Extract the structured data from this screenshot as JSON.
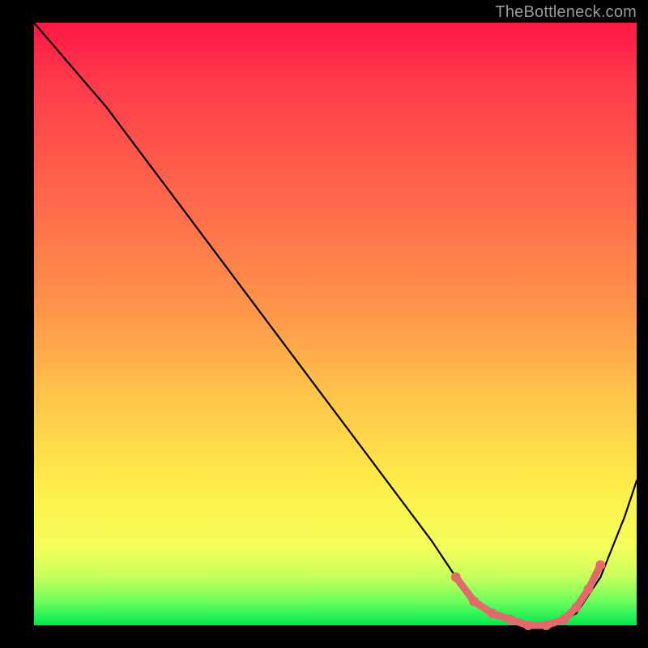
{
  "watermark": "TheBottleneck.com",
  "chart_data": {
    "type": "line",
    "title": "",
    "xlabel": "",
    "ylabel": "",
    "xlim": [
      0,
      100
    ],
    "ylim": [
      0,
      100
    ],
    "series": [
      {
        "name": "bottleneck-curve",
        "x": [
          0,
          6,
          12,
          18,
          24,
          30,
          36,
          42,
          48,
          54,
          60,
          66,
          70,
          74,
          78,
          82,
          86,
          90,
          94,
          98,
          100
        ],
        "y": [
          100,
          93,
          86,
          78,
          70,
          62,
          54,
          46,
          38,
          30,
          22,
          14,
          8,
          3,
          1,
          0,
          0,
          2,
          8,
          18,
          24
        ]
      }
    ],
    "highlight": {
      "name": "optimal-range",
      "x": [
        70,
        73,
        76,
        79,
        82,
        85,
        88,
        90,
        92,
        94
      ],
      "y": [
        8,
        4,
        2,
        1,
        0,
        0,
        1,
        3,
        6,
        10
      ]
    }
  }
}
